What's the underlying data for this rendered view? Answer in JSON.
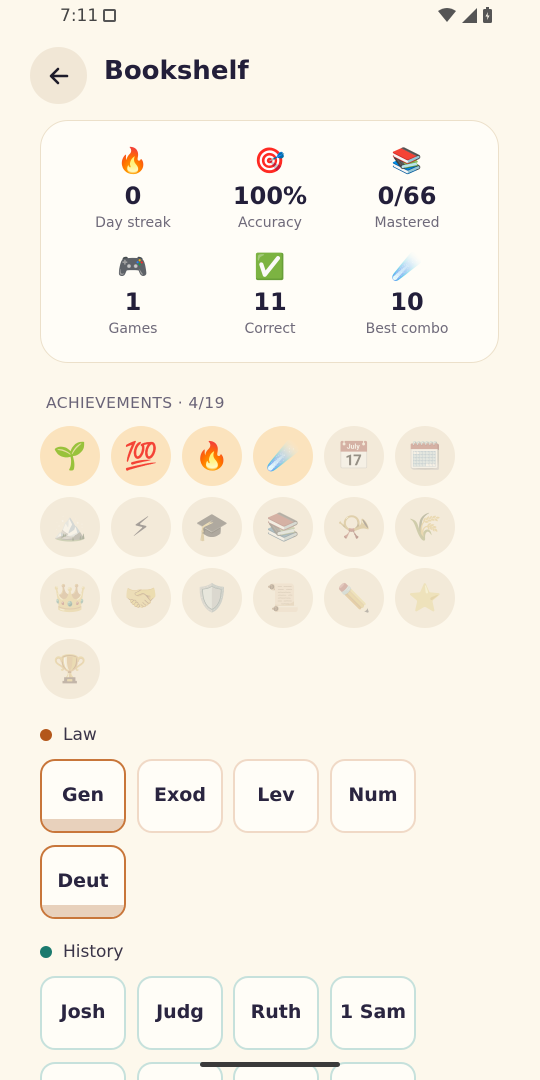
{
  "status": {
    "time": "7:11"
  },
  "header": {
    "title": "Bookshelf"
  },
  "stats": [
    {
      "emoji": "🔥",
      "value": "0",
      "label": "Day streak"
    },
    {
      "emoji": "🎯",
      "value": "100%",
      "label": "Accuracy"
    },
    {
      "emoji": "📚",
      "value": "0/66",
      "label": "Mastered"
    },
    {
      "emoji": "🎮",
      "value": "1",
      "label": "Games"
    },
    {
      "emoji": "✅",
      "value": "11",
      "label": "Correct"
    },
    {
      "emoji": "☄️",
      "value": "10",
      "label": "Best combo"
    }
  ],
  "achievements": {
    "header": "ACHIEVEMENTS · 4/19",
    "items": [
      {
        "emoji": "🌱",
        "unlocked": true
      },
      {
        "emoji": "💯",
        "unlocked": true
      },
      {
        "emoji": "🔥",
        "unlocked": true
      },
      {
        "emoji": "☄️",
        "unlocked": true
      },
      {
        "emoji": "📅",
        "unlocked": false
      },
      {
        "emoji": "🗓️",
        "unlocked": false
      },
      {
        "emoji": "🏔️",
        "unlocked": false
      },
      {
        "emoji": "⚡",
        "unlocked": false
      },
      {
        "emoji": "🎓",
        "unlocked": false
      },
      {
        "emoji": "📚",
        "unlocked": false
      },
      {
        "emoji": "📯",
        "unlocked": false
      },
      {
        "emoji": "🌾",
        "unlocked": false
      },
      {
        "emoji": "👑",
        "unlocked": false
      },
      {
        "emoji": "🤝",
        "unlocked": false
      },
      {
        "emoji": "🛡️",
        "unlocked": false
      },
      {
        "emoji": "📜",
        "unlocked": false
      },
      {
        "emoji": "✏️",
        "unlocked": false
      },
      {
        "emoji": "⭐",
        "unlocked": false
      },
      {
        "emoji": "🏆",
        "unlocked": false
      }
    ]
  },
  "sections": {
    "law": {
      "label": "Law",
      "color": "#b3571b",
      "books": [
        "Gen",
        "Exod",
        "Lev",
        "Num",
        "Deut"
      ],
      "highlighted": [
        "Gen",
        "Deut"
      ]
    },
    "history": {
      "label": "History",
      "color": "#1b7a6e",
      "books": [
        "Josh",
        "Judg",
        "Ruth",
        "1 Sam"
      ]
    }
  },
  "colors": {
    "background": "#fdf8ec",
    "card": "#fffdf7",
    "law_accent": "#c8763a",
    "history_border": "#c6e1dc"
  }
}
